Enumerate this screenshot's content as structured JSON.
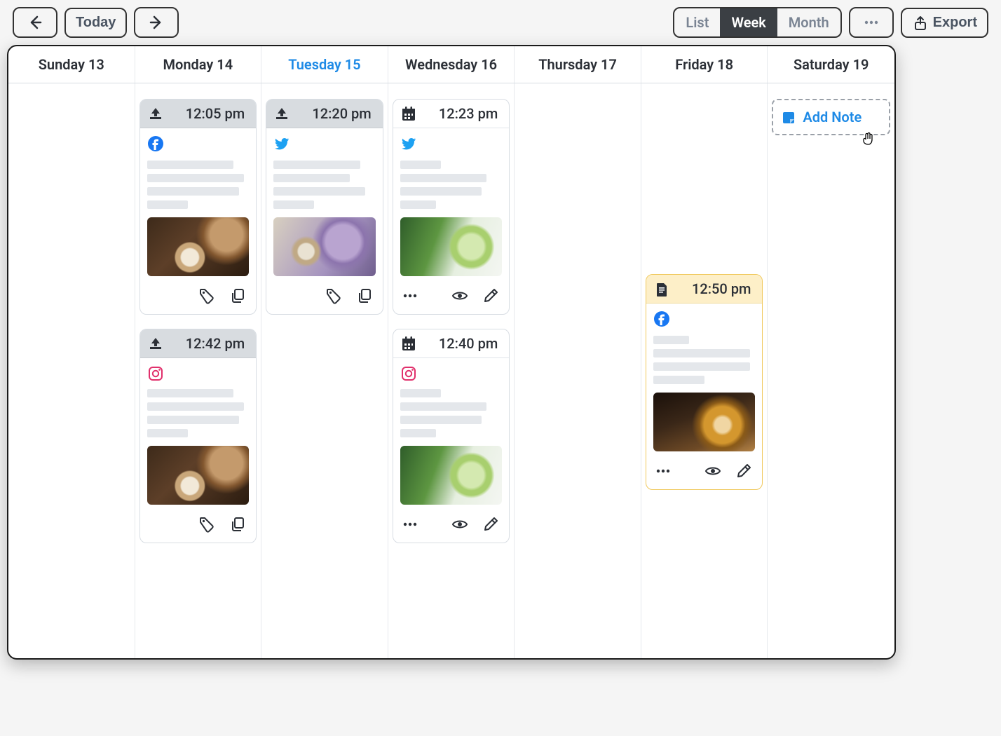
{
  "toolbar": {
    "today_label": "Today",
    "views": {
      "list": "List",
      "week": "Week",
      "month": "Month",
      "active": "week"
    },
    "export_label": "Export"
  },
  "days": [
    {
      "label": "Sunday 13",
      "today": false
    },
    {
      "label": "Monday 14",
      "today": false
    },
    {
      "label": "Tuesday 15",
      "today": true
    },
    {
      "label": "Wednesday 16",
      "today": false
    },
    {
      "label": "Thursday 17",
      "today": false
    },
    {
      "label": "Friday 18",
      "today": false
    },
    {
      "label": "Saturday 19",
      "today": false
    }
  ],
  "posts": {
    "mon1": {
      "time": "12:05 pm",
      "status": "scheduled",
      "platform": "facebook",
      "thumb": "coffee",
      "actions": [
        "tag",
        "copy"
      ]
    },
    "mon2": {
      "time": "12:42 pm",
      "status": "scheduled",
      "platform": "instagram",
      "thumb": "coffee",
      "actions": [
        "tag",
        "copy"
      ]
    },
    "tue1": {
      "time": "12:20 pm",
      "status": "scheduled",
      "platform": "twitter",
      "thumb": "lilac",
      "actions": [
        "tag",
        "copy"
      ]
    },
    "wed1": {
      "time": "12:23 pm",
      "status": "posted",
      "platform": "twitter",
      "thumb": "matcha",
      "actions": [
        "more",
        "view",
        "edit"
      ]
    },
    "wed2": {
      "time": "12:40 pm",
      "status": "posted",
      "platform": "instagram",
      "thumb": "matcha",
      "actions": [
        "more",
        "view",
        "edit"
      ]
    },
    "fri1": {
      "time": "12:50 pm",
      "status": "draft",
      "platform": "facebook",
      "thumb": "whiskey",
      "actions": [
        "more",
        "view",
        "edit"
      ]
    }
  },
  "add_note_label": "Add Note",
  "icons": {
    "facebook": "facebook",
    "twitter": "twitter",
    "instagram": "instagram"
  },
  "colors": {
    "accent": "#1e8ae6",
    "draft_border": "#f0c85a",
    "draft_bg": "#fdefc8"
  }
}
